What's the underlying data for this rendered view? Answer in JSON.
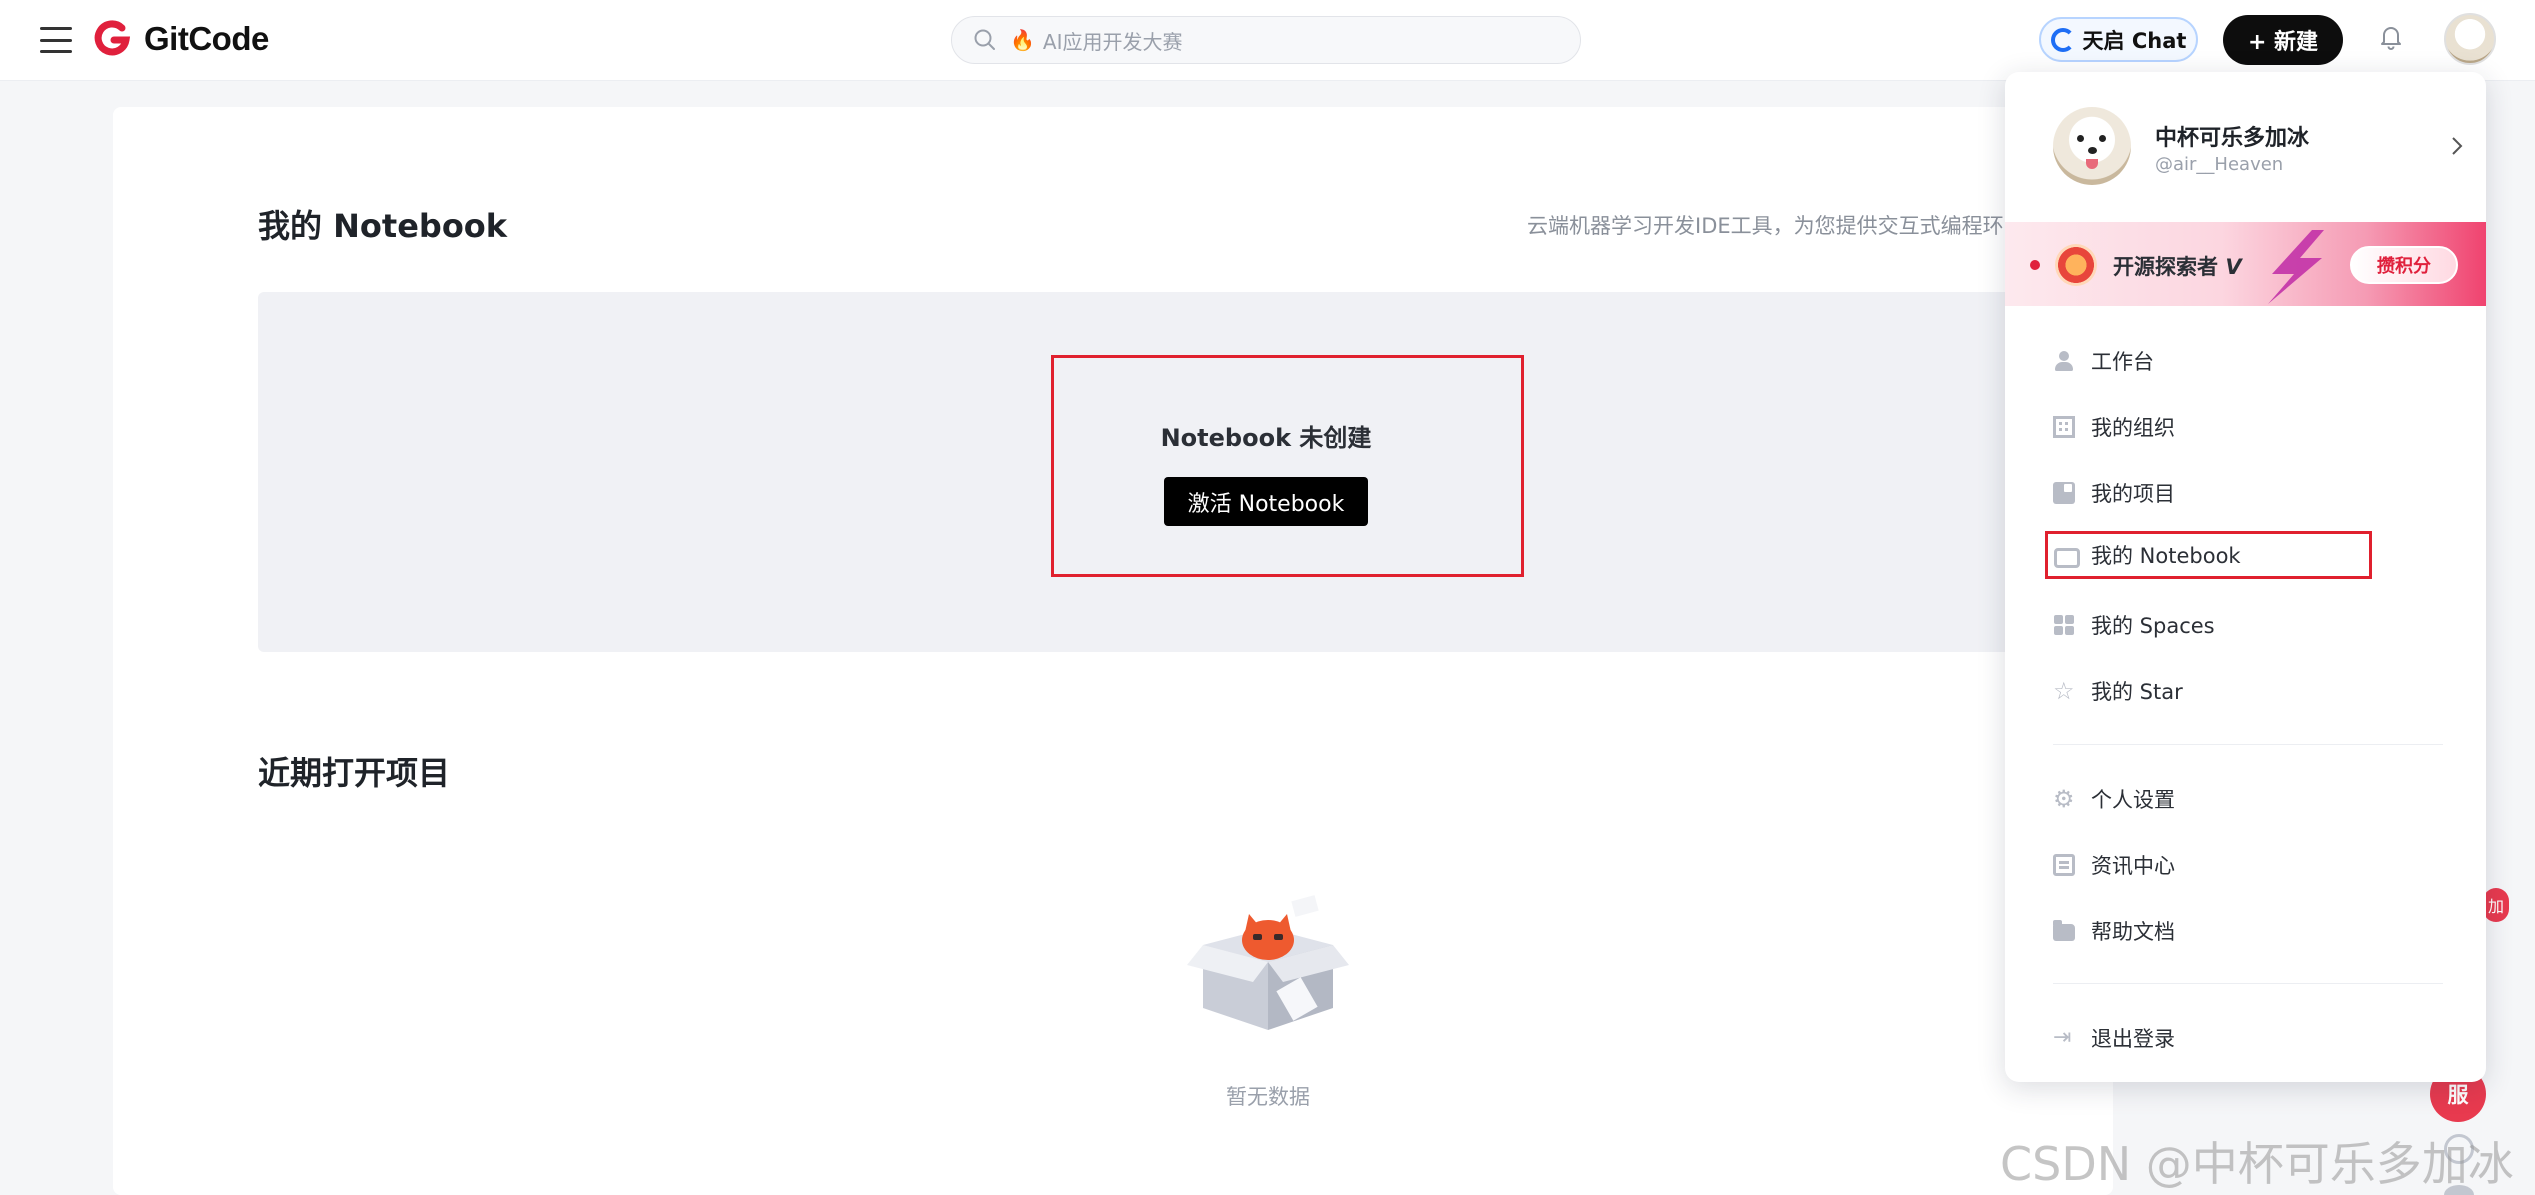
{
  "header": {
    "logo_text": "GitCode",
    "search_placeholder": "AI应用开发大赛",
    "tianqi_label": "天启 Chat",
    "new_label": "+ 新建"
  },
  "page": {
    "title": "我的 Notebook",
    "description": "云端机器学习开发IDE工具，为您提供交互式编程环",
    "notebook_status": "Notebook 未创建",
    "activate_label": "激活 Notebook",
    "recent_title": "近期打开项目",
    "empty_text": "暂无数据"
  },
  "dropdown": {
    "user_name": "中杯可乐多加冰",
    "user_handle": "@air__Heaven",
    "banner_label": "开源探索者",
    "banner_level": "V",
    "banner_action": "攒积分",
    "items": [
      {
        "label": "工作台",
        "icon": "user-icon"
      },
      {
        "label": "我的组织",
        "icon": "organization-icon"
      },
      {
        "label": "我的项目",
        "icon": "project-icon"
      },
      {
        "label": "我的 Notebook",
        "icon": "notebook-icon"
      },
      {
        "label": "我的 Spaces",
        "icon": "spaces-icon"
      },
      {
        "label": "我的 Star",
        "icon": "star-icon"
      }
    ],
    "settings_items": [
      {
        "label": "个人设置",
        "icon": "gear-icon"
      },
      {
        "label": "资讯中心",
        "icon": "news-icon"
      },
      {
        "label": "帮助文档",
        "icon": "folder-icon"
      }
    ],
    "logout_label": "退出登录"
  },
  "floating": {
    "service_label": "服",
    "badge_label": "加"
  },
  "watermark": "CSDN @中杯可乐多加冰",
  "colors": {
    "brand": "#e0203c",
    "highlight": "#e0202e",
    "button_dark": "#000000"
  }
}
